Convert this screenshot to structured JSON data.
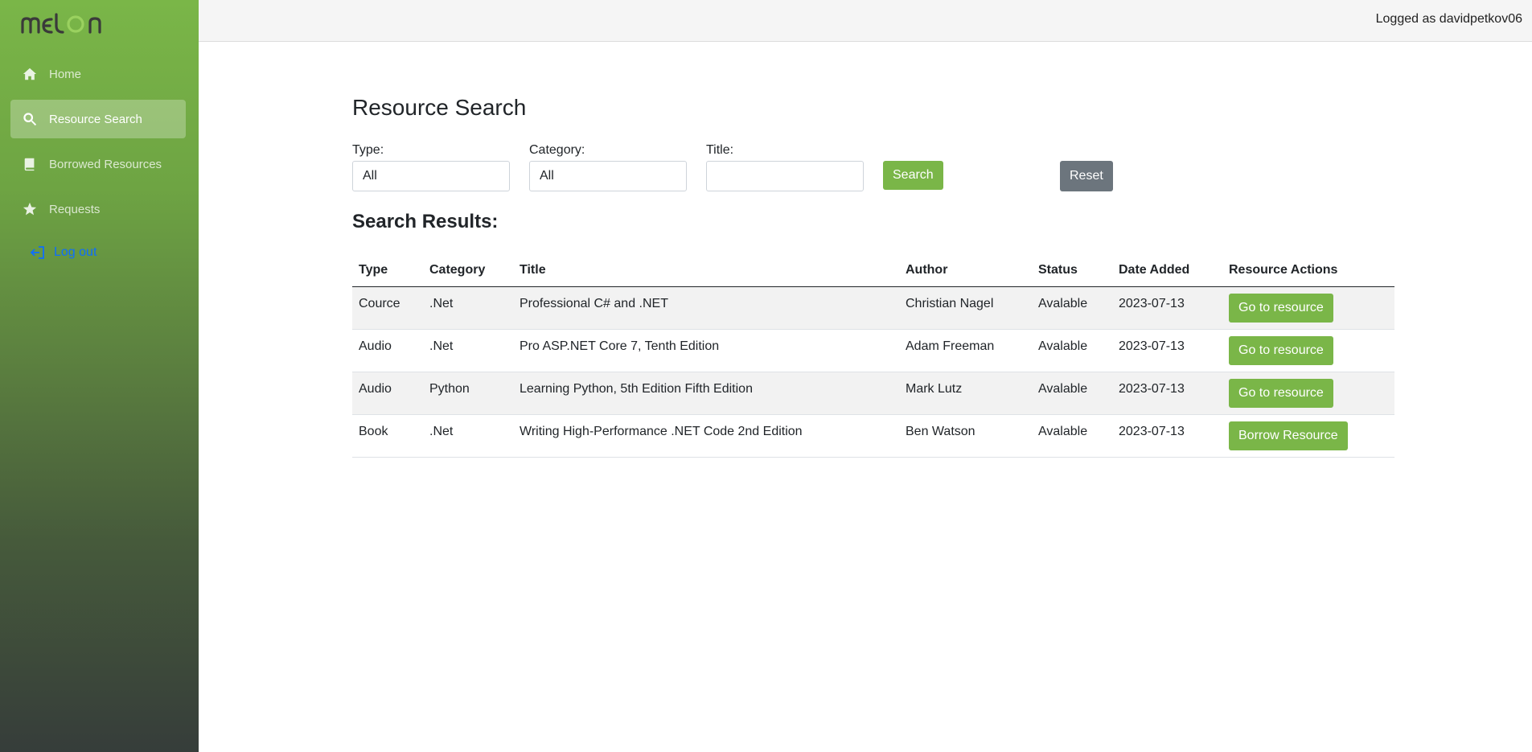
{
  "app": {
    "logo_text": "MELON",
    "logged_text": "Logged as davidpetkov06"
  },
  "sidebar": {
    "items": [
      {
        "label": "Home",
        "icon": "home-icon"
      },
      {
        "label": "Resource Search",
        "icon": "search-icon",
        "active": true
      },
      {
        "label": "Borrowed Resources",
        "icon": "book-icon"
      },
      {
        "label": "Requests",
        "icon": "star-icon"
      }
    ],
    "logout_label": "Log out"
  },
  "main": {
    "title": "Resource Search",
    "filters": {
      "type_label": "Type:",
      "type_value": "All",
      "category_label": "Category:",
      "category_value": "All",
      "title_label": "Title:",
      "title_value": ""
    },
    "search_label": "Search",
    "reset_label": "Reset",
    "results_title": "Search Results:",
    "table": {
      "headers": [
        "Type",
        "Category",
        "Title",
        "Author",
        "Status",
        "Date Added",
        "Resource Actions"
      ],
      "rows": [
        {
          "type": "Cource",
          "category": ".Net",
          "title": "Professional C# and .NET",
          "author": "Christian Nagel",
          "status": "Avalable",
          "date": "2023-07-13",
          "action": "Go to resource"
        },
        {
          "type": "Audio",
          "category": ".Net",
          "title": "Pro ASP.NET Core 7, Tenth Edition",
          "author": "Adam Freeman",
          "status": "Avalable",
          "date": "2023-07-13",
          "action": "Go to resource"
        },
        {
          "type": "Audio",
          "category": "Python",
          "title": "Learning Python, 5th Edition Fifth Edition",
          "author": "Mark Lutz",
          "status": "Avalable",
          "date": "2023-07-13",
          "action": "Go to resource"
        },
        {
          "type": "Book",
          "category": ".Net",
          "title": "Writing High-Performance .NET Code 2nd Edition",
          "author": "Ben Watson",
          "status": "Avalable",
          "date": "2023-07-13",
          "action": "Borrow Resource"
        }
      ]
    }
  },
  "colors": {
    "accent": "#7ab648",
    "reset": "#6c757d",
    "link": "#0d6efd"
  }
}
